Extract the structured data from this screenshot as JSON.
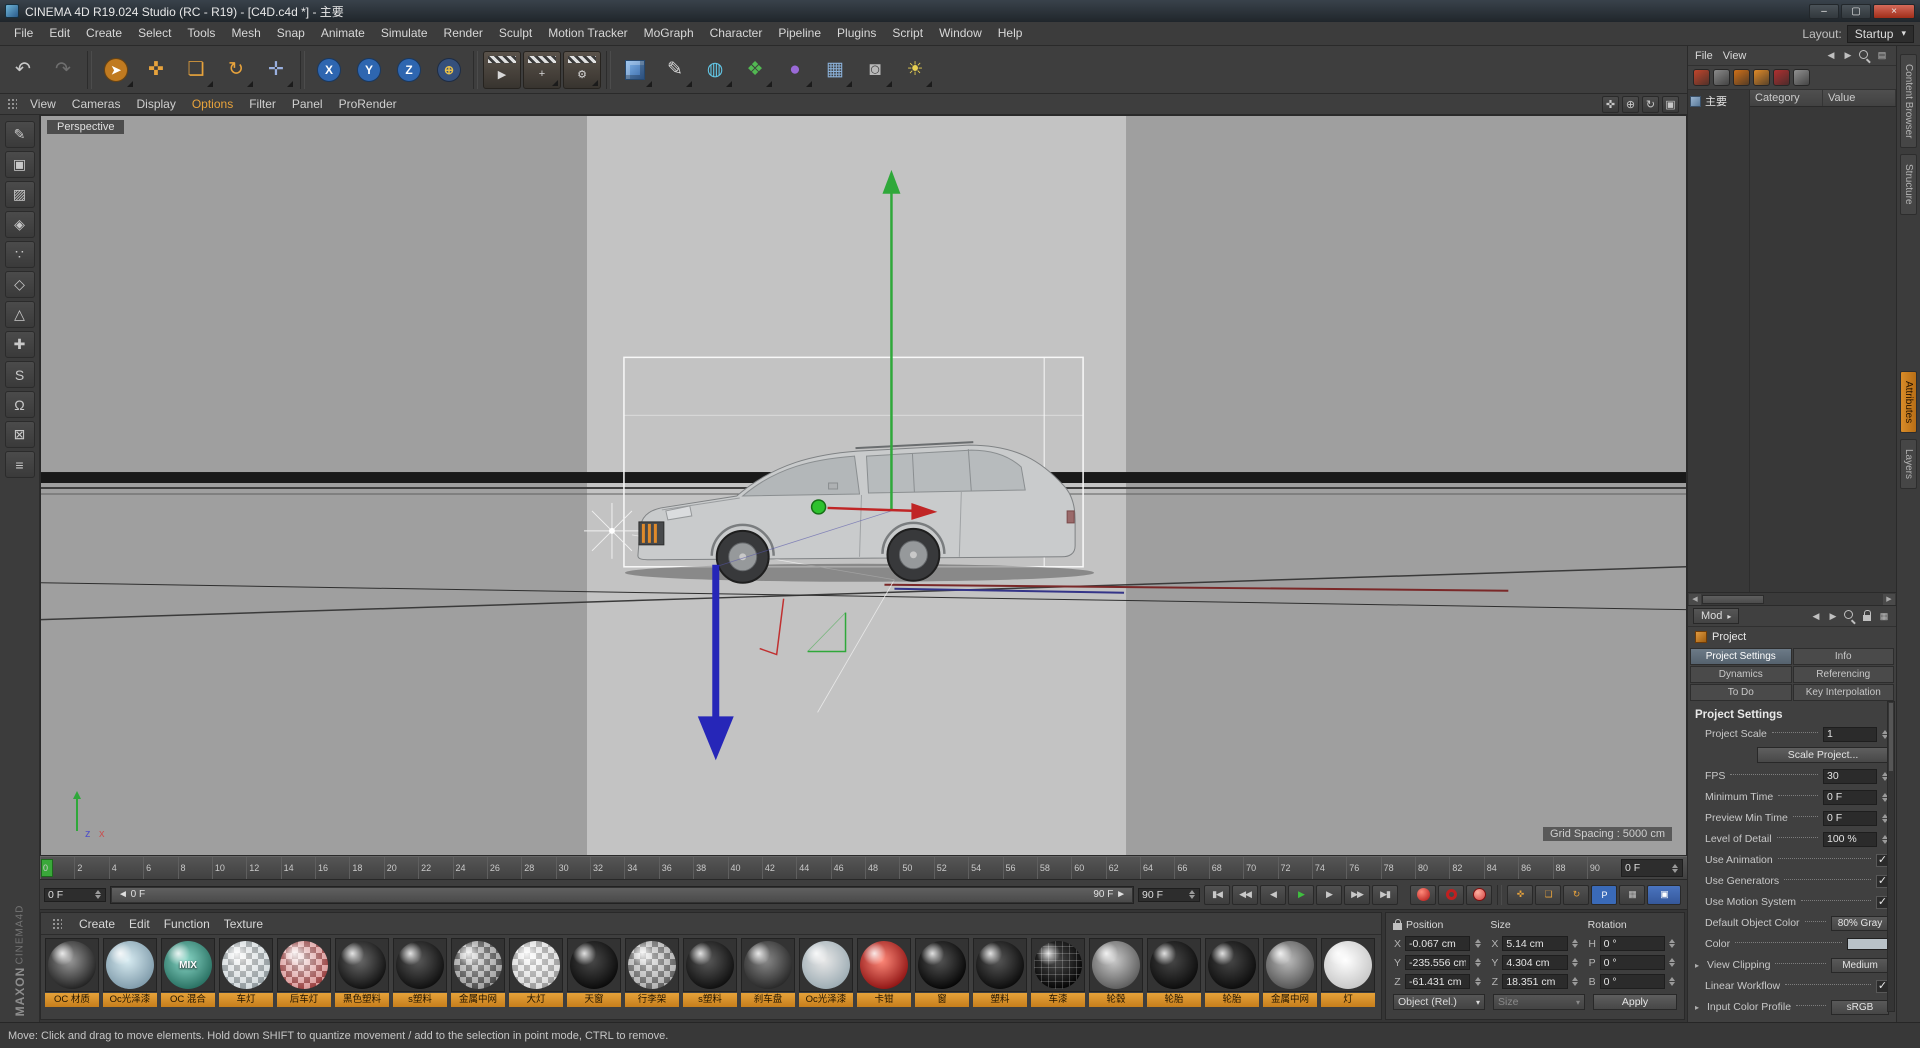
{
  "theme": {
    "accent": "#e8a33c",
    "viewport_bg": "#9f9f9f",
    "viewport_center": "#c3c3c3"
  },
  "window": {
    "title": "CINEMA 4D R19.024 Studio (RC - R19) - [C4D.c4d *] - 主要",
    "controls": {
      "minimize": "–",
      "maximize": "▢",
      "close": "×"
    }
  },
  "menubar": {
    "items": [
      "File",
      "Edit",
      "Create",
      "Select",
      "Tools",
      "Mesh",
      "Snap",
      "Animate",
      "Simulate",
      "Render",
      "Sculpt",
      "Motion Tracker",
      "MoGraph",
      "Character",
      "Pipeline",
      "Plugins",
      "Script",
      "Window",
      "Help"
    ],
    "layout_label": "Layout:",
    "layout_value": "Startup"
  },
  "toolbar": {
    "icons": [
      {
        "name": "undo-button",
        "glyph": "↶",
        "fg": "#c9c9c9"
      },
      {
        "name": "redo-button",
        "glyph": "↷",
        "fg": "#6e6e6e"
      },
      {
        "sep": true
      },
      {
        "name": "live-selection-tool",
        "glyph": "➤",
        "fg": "#ffffff",
        "bg": "#c07a20",
        "round": true,
        "dd": true
      },
      {
        "name": "move-tool",
        "glyph": "✜",
        "fg": "#e8a33c"
      },
      {
        "name": "scale-tool",
        "glyph": "❏",
        "fg": "#e8a33c",
        "dd": true
      },
      {
        "name": "rotate-tool",
        "glyph": "↻",
        "fg": "#e8a33c",
        "dd": true
      },
      {
        "name": "last-used-tool",
        "glyph": "✛",
        "fg": "#9ab0e0",
        "dd": true
      },
      {
        "sep": true
      },
      {
        "name": "lock-x-axis-button",
        "glyph": "X",
        "fg": "#ffffff",
        "bg": "#2e66b0",
        "round": true
      },
      {
        "name": "lock-y-axis-button",
        "glyph": "Y",
        "fg": "#ffffff",
        "bg": "#2e66b0",
        "round": true
      },
      {
        "name": "lock-z-axis-button",
        "glyph": "Z",
        "fg": "#ffffff",
        "bg": "#2e66b0",
        "round": true
      },
      {
        "name": "coordinate-system-button",
        "glyph": "⊕",
        "fg": "#e8c04a",
        "bg": "#35507c",
        "round": true
      },
      {
        "sep": true
      },
      {
        "name": "render-view-button",
        "glyph": "▶",
        "fg": "#d8d8d8",
        "clapper": true
      },
      {
        "name": "render-to-picture-viewer-button",
        "glyph": "+",
        "fg": "#d8d8d8",
        "clapper": true,
        "dd": true
      },
      {
        "name": "render-settings-button",
        "glyph": "⚙",
        "fg": "#d8d8d8",
        "clapper": true,
        "dd": true
      },
      {
        "sep": true
      },
      {
        "name": "add-cube-object-button",
        "cube": true,
        "dd": true
      },
      {
        "name": "add-spline-pen-button",
        "glyph": "✎",
        "fg": "#d8d8d8",
        "dd": true
      },
      {
        "name": "add-subdivision-surface-button",
        "glyph": "◍",
        "fg": "#62c8e8",
        "dd": true
      },
      {
        "name": "add-generator-button",
        "glyph": "❖",
        "fg": "#52b852",
        "dd": true
      },
      {
        "name": "add-deformer-button",
        "glyph": "●",
        "fg": "#9a6ad8",
        "dd": true
      },
      {
        "name": "add-environment-button",
        "glyph": "▦",
        "fg": "#8ab0d8",
        "dd": true
      },
      {
        "name": "add-camera-button",
        "glyph": "◙",
        "fg": "#b8b8b8",
        "dd": true
      },
      {
        "name": "add-light-button",
        "glyph": "☀",
        "fg": "#e8d052",
        "dd": true
      }
    ]
  },
  "viewport_menu": {
    "items": [
      {
        "label": "View"
      },
      {
        "label": "Cameras"
      },
      {
        "label": "Display"
      },
      {
        "label": "Options",
        "accent": true
      },
      {
        "label": "Filter"
      },
      {
        "label": "Panel"
      },
      {
        "label": "ProRender"
      }
    ],
    "right_icons": [
      {
        "name": "viewport-pan-icon",
        "glyph": "✜"
      },
      {
        "name": "viewport-zoom-icon",
        "glyph": "⊕"
      },
      {
        "name": "viewport-rotate-icon",
        "glyph": "↻"
      },
      {
        "name": "viewport-maximize-icon",
        "glyph": "▣"
      }
    ]
  },
  "left_toolbar": [
    {
      "name": "make-editable-button",
      "glyph": "✎"
    },
    {
      "name": "model-mode-button",
      "glyph": "▣"
    },
    {
      "name": "texture-mode-button",
      "glyph": "▨"
    },
    {
      "name": "workplane-mode-button",
      "glyph": "◈"
    },
    {
      "name": "points-mode-button",
      "glyph": "∵"
    },
    {
      "name": "edges-mode-button",
      "glyph": "◇"
    },
    {
      "name": "polygons-mode-button",
      "glyph": "△"
    },
    {
      "name": "enable-axis-button",
      "glyph": "✚"
    },
    {
      "name": "viewport-solo-button",
      "glyph": "S"
    },
    {
      "name": "enable-snap-button",
      "glyph": "Ω"
    },
    {
      "name": "lock-workplane-button",
      "glyph": "⊠"
    },
    {
      "name": "modeling-settings-button",
      "glyph": "≡"
    }
  ],
  "viewport": {
    "camera_label": "Perspective",
    "grid_label": "Grid Spacing : 5000 cm",
    "axis_z": "z",
    "axis_x": "x"
  },
  "timeline": {
    "ticks": [
      "0",
      "2",
      "4",
      "6",
      "8",
      "10",
      "12",
      "14",
      "16",
      "18",
      "20",
      "22",
      "24",
      "26",
      "28",
      "30",
      "32",
      "34",
      "36",
      "38",
      "40",
      "42",
      "44",
      "46",
      "48",
      "50",
      "52",
      "54",
      "56",
      "58",
      "60",
      "62",
      "64",
      "66",
      "68",
      "70",
      "72",
      "74",
      "76",
      "78",
      "80",
      "82",
      "84",
      "86",
      "88",
      "90"
    ],
    "ruler_end_value": "0 F",
    "current_frame": "0 F",
    "range_start": "◄ 0 F",
    "range_end": "90 F ►",
    "end_frame": "90 F",
    "transport": [
      {
        "name": "go-to-start-button",
        "glyph": "▮◀"
      },
      {
        "name": "previous-key-button",
        "glyph": "◀◀"
      },
      {
        "name": "previous-frame-button",
        "glyph": "◀"
      },
      {
        "name": "play-button",
        "glyph": "▶",
        "fg": "#3fbf3f"
      },
      {
        "name": "next-frame-button",
        "glyph": "▶"
      },
      {
        "name": "next-key-button",
        "glyph": "▶▶"
      },
      {
        "name": "go-to-end-button",
        "glyph": "▶▮"
      }
    ],
    "record": [
      {
        "name": "record-keyframe-button",
        "kind": "dot"
      },
      {
        "name": "autokeying-button",
        "kind": "ring"
      },
      {
        "name": "record-selected-button",
        "kind": "dot2"
      },
      {
        "sep": true
      },
      {
        "name": "record-position-toggle",
        "glyph": "✜",
        "fg": "#e8a33c"
      },
      {
        "name": "record-scale-toggle",
        "glyph": "❏",
        "fg": "#e8a33c"
      },
      {
        "name": "record-rotation-toggle",
        "glyph": "↻",
        "fg": "#e8a33c"
      },
      {
        "name": "record-parameter-toggle",
        "glyph": "P",
        "fg": "#ffffff",
        "bg": "#3a6ab8"
      },
      {
        "name": "record-pla-toggle",
        "glyph": "▦",
        "fg": "#c0c0c0"
      },
      {
        "name": "keyframe-selection-button",
        "glyph": "▣",
        "wide": true
      }
    ]
  },
  "materials": {
    "menu": [
      "Create",
      "Edit",
      "Function",
      "Texture"
    ],
    "items": [
      {
        "label": "OC 材质",
        "c1": "#9a9a9a",
        "c2": "#1a1a1a"
      },
      {
        "label": "Oc光泽漆",
        "c1": "#d8ecf2",
        "c2": "#7a96a6"
      },
      {
        "label": "OC 混合",
        "c1": "#8ad8c8",
        "c2": "#236a5c",
        "text": "MIX"
      },
      {
        "label": "车灯",
        "c1": "#f2f2f2",
        "c2": "#aab8be",
        "checker": true
      },
      {
        "label": "后车灯",
        "c1": "#f2d8d8",
        "c2": "#b83a3a",
        "checker": true
      },
      {
        "label": "黑色塑料",
        "c1": "#6a6a6a",
        "c2": "#0a0a0a"
      },
      {
        "label": "s塑料",
        "c1": "#5a5a5a",
        "c2": "#0a0a0a"
      },
      {
        "label": "金属中网",
        "c1": "#c0c0c0",
        "c2": "#4a4a4a",
        "checker": true
      },
      {
        "label": "大灯",
        "c1": "#f8f8f8",
        "c2": "#b8b8b8",
        "checker": true
      },
      {
        "label": "天窗",
        "c1": "#4a4a4a",
        "c2": "#060606"
      },
      {
        "label": "行李架",
        "c1": "#d0d0d0",
        "c2": "#6a6a6a",
        "checker": true
      },
      {
        "label": "s塑料",
        "c1": "#5a5a5a",
        "c2": "#0a0a0a"
      },
      {
        "label": "刹车盘",
        "c1": "#8a8a8a",
        "c2": "#222222"
      },
      {
        "label": "Oc光泽漆",
        "c1": "#e8e8e8",
        "c2": "#98a8b0"
      },
      {
        "label": "卡钳",
        "c1": "#ff8a7a",
        "c2": "#8a0e0e"
      },
      {
        "label": "窗",
        "c1": "#555555",
        "c2": "#000000"
      },
      {
        "label": "塑料",
        "c1": "#585858",
        "c2": "#060606"
      },
      {
        "label": "车漆",
        "c1": "#4a4a4a",
        "c2": "#000000",
        "wire": true
      },
      {
        "label": "轮毂",
        "c1": "#cacaca",
        "c2": "#565656"
      },
      {
        "label": "轮胎",
        "c1": "#484848",
        "c2": "#080808"
      },
      {
        "label": "轮胎",
        "c1": "#484848",
        "c2": "#080808"
      },
      {
        "label": "金属中网",
        "c1": "#bcbcbc",
        "c2": "#4e4e4e"
      },
      {
        "label": "灯",
        "c1": "#ffffff",
        "c2": "#c4c4c4"
      }
    ]
  },
  "coords": {
    "columns": [
      {
        "header": "Position",
        "rows": [
          {
            "axis": "X",
            "value": "-0.067 cm"
          },
          {
            "axis": "Y",
            "value": "-235.556 cm"
          },
          {
            "axis": "Z",
            "value": "-61.431 cm"
          }
        ]
      },
      {
        "header": "Size",
        "rows": [
          {
            "axis": "X",
            "value": "5.14 cm"
          },
          {
            "axis": "Y",
            "value": "4.304 cm"
          },
          {
            "axis": "Z",
            "value": "18.351 cm"
          }
        ]
      },
      {
        "header": "Rotation",
        "rows": [
          {
            "axis": "H",
            "value": "0 °"
          },
          {
            "axis": "P",
            "value": "0 °"
          },
          {
            "axis": "B",
            "value": "0 °"
          }
        ]
      }
    ],
    "object_mode": "Object (Rel.)",
    "size_mode": "Size",
    "apply_label": "Apply"
  },
  "status_bar": "Move: Click and drag to move elements. Hold down SHIFT to quantize movement / add to the selection in point mode, CTRL to remove.",
  "right_panel": {
    "file_menu": "File",
    "view_menu": "View",
    "menu_icons": [
      {
        "name": "dock-back-icon",
        "glyph": "◀"
      },
      {
        "name": "dock-forward-icon",
        "glyph": "▶"
      },
      {
        "name": "panel-search-icon",
        "css": "mag"
      },
      {
        "name": "panel-menu-icon",
        "glyph": "▤"
      }
    ],
    "browser_icons": [
      {
        "name": "objects-icon",
        "color": "#c2452b"
      },
      {
        "name": "tags-icon",
        "color": "#8a8a8a"
      },
      {
        "name": "history-icon",
        "color": "#d07018"
      },
      {
        "name": "bookmarks-icon",
        "color": "#e08a28"
      },
      {
        "name": "presets-icon",
        "color": "#b03030"
      },
      {
        "name": "settings-icon",
        "color": "#909090"
      }
    ],
    "tree_node": "主要",
    "columns": [
      "Category",
      "Value"
    ],
    "mode_label": "Mod",
    "mode_icons": [
      {
        "name": "history-back-icon",
        "glyph": "◀"
      },
      {
        "name": "history-forward-icon",
        "glyph": "▶"
      },
      {
        "name": "search-icon",
        "css": "mag"
      },
      {
        "name": "lock-icon",
        "css": "lock"
      },
      {
        "name": "layout-grid-icon",
        "glyph": "▦"
      }
    ],
    "object_label": "Project",
    "tabs": [
      {
        "label": "Project Settings",
        "active": true
      },
      {
        "label": "Info"
      },
      {
        "label": "Dynamics"
      },
      {
        "label": "Referencing"
      },
      {
        "label": "To Do"
      },
      {
        "label": "Key Interpolation"
      }
    ],
    "section_heading": "Project Settings",
    "rows": [
      {
        "label": "Project Scale",
        "type": "number",
        "value": "1"
      },
      {
        "type": "button",
        "value": "Scale Project..."
      },
      {
        "label": "FPS",
        "type": "number",
        "value": "30"
      },
      {
        "label": "Minimum Time",
        "type": "number",
        "value": "0 F"
      },
      {
        "label": "Preview Min Time",
        "type": "number",
        "value": "0 F"
      },
      {
        "label": "Level of Detail",
        "type": "number",
        "value": "100 %"
      },
      {
        "label": "Use Animation",
        "type": "check",
        "checked": true
      },
      {
        "label": "Use Generators",
        "type": "check",
        "checked": true
      },
      {
        "label": "Use Motion System",
        "type": "check",
        "checked": true
      },
      {
        "label": "Default Object Color",
        "type": "dropdown",
        "value": "80% Gray"
      },
      {
        "label": "Color",
        "type": "color",
        "value": "#b9c2c8"
      },
      {
        "label": "View Clipping",
        "type": "dropdown",
        "value": "Medium",
        "expander": true
      },
      {
        "label": "Linear Workflow",
        "type": "check",
        "checked": true
      },
      {
        "label": "Input Color Profile",
        "type": "dropdown",
        "value": "sRGB",
        "expander": true
      }
    ]
  },
  "side_tabs": [
    {
      "label": "Content Browser",
      "area": "top"
    },
    {
      "label": "Structure",
      "area": "top"
    },
    {
      "label": "Attributes",
      "area": "mid",
      "active": true
    },
    {
      "label": "Layers",
      "area": "mid"
    }
  ]
}
